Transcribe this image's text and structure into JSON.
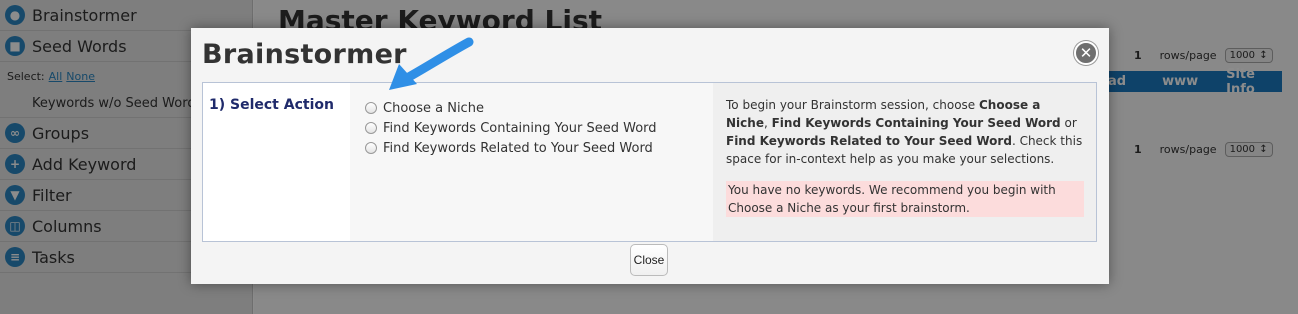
{
  "sidebar": {
    "items": [
      {
        "label": "Brainstormer",
        "icon": "lightbulb-icon"
      },
      {
        "label": "Seed Words",
        "icon": "cube-icon"
      }
    ],
    "select_label": "Select:",
    "select_all": "All",
    "select_none": "None",
    "sub_item": "Keywords w/o Seed Words",
    "items2": [
      {
        "label": "Groups",
        "icon": "groups-icon"
      },
      {
        "label": "Add Keyword",
        "icon": "plus-icon"
      },
      {
        "label": "Filter",
        "icon": "filter-icon"
      },
      {
        "label": "Columns",
        "icon": "columns-icon"
      },
      {
        "label": "Tasks",
        "icon": "tasks-icon"
      }
    ]
  },
  "main": {
    "title": "Master Keyword List",
    "page_num": "1",
    "rows_label": "rows/page",
    "rows_value": "1000",
    "col_headers": [
      "ad",
      "www",
      "Site Info"
    ]
  },
  "modal": {
    "title": "Brainstormer",
    "step_label": "1) Select Action",
    "options": [
      "Choose a Niche",
      "Find Keywords Containing Your Seed Word",
      "Find Keywords Related to Your Seed Word"
    ],
    "help": {
      "intro": "To begin your Brainstorm session, choose ",
      "b1": "Choose a Niche",
      "sep1": ", ",
      "b2": "Find Keywords Containing Your Seed Word",
      "sep2": " or ",
      "b3": "Find Keywords Related to Your Seed Word",
      "outro": ". Check this space for in-context help as you make your selections."
    },
    "warning": "You have no keywords. We recommend you begin with Choose a Niche as your first brainstorm.",
    "close_button": "Close"
  },
  "colors": {
    "accent": "#1a79bf",
    "step_text": "#1f2a6b",
    "warning_bg": "#fcdcdc",
    "arrow": "#2f8fe6"
  }
}
